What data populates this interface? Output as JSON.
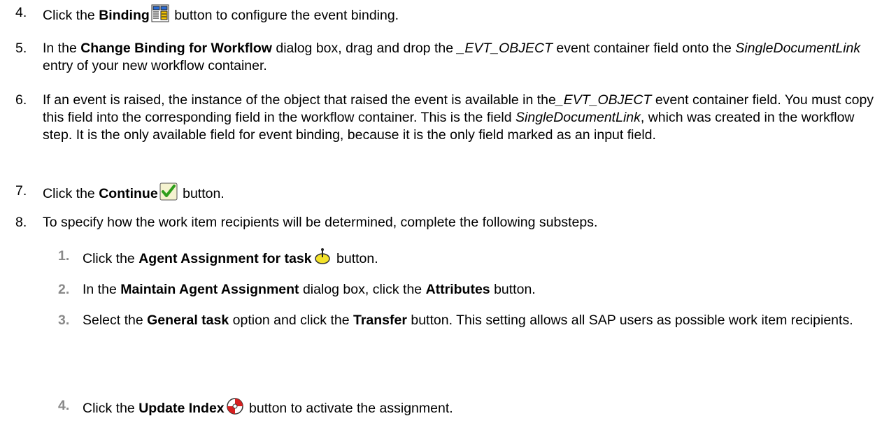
{
  "steps": [
    {
      "num": "4.",
      "parts": [
        {
          "t": "Click the "
        },
        {
          "t": "Binding",
          "b": true
        },
        {
          "t": " ",
          "icon": "binding-icon"
        },
        {
          "t": " button to configure the event binding."
        }
      ]
    },
    {
      "num": "5.",
      "parts": [
        {
          "t": "In the "
        },
        {
          "t": "Change Binding for Workflow",
          "b": true
        },
        {
          "t": " dialog box, drag and drop the "
        },
        {
          "t": "_EVT_OBJECT",
          "i": true
        },
        {
          "t": " event container field onto the "
        },
        {
          "t": "SingleDocumentLink",
          "i": true
        },
        {
          "t": " entry of your new workflow container."
        }
      ]
    },
    {
      "num": "6.",
      "parts": [
        {
          "t": "If an event is raised, the instance of the object that raised the event is available in the"
        },
        {
          "t": "_EVT_OBJECT",
          "i": true
        },
        {
          "t": " event container field. You must copy this field into the corresponding field in the workflow container. This is the field "
        },
        {
          "t": "SingleDocumentLink",
          "i": true
        },
        {
          "t": ", which was created in the workflow step. It is the only available field for event binding, because it is the only field marked as an input field."
        }
      ]
    },
    {
      "num": "7.",
      "parts": [
        {
          "t": "Click the "
        },
        {
          "t": "Continue",
          "b": true
        },
        {
          "t": " ",
          "icon": "checkmark-icon"
        },
        {
          "t": " button."
        }
      ]
    },
    {
      "num": "8.",
      "parts": [
        {
          "t": "To specify how the work item recipients will be determined, complete the following substeps."
        }
      ]
    }
  ],
  "substeps": [
    {
      "num": "1.",
      "parts": [
        {
          "t": "Click the "
        },
        {
          "t": "Agent Assignment for task",
          "b": true
        },
        {
          "t": " ",
          "icon": "agent-assignment-icon"
        },
        {
          "t": " button."
        }
      ]
    },
    {
      "num": "2.",
      "parts": [
        {
          "t": "In the "
        },
        {
          "t": "Maintain Agent Assignment",
          "b": true
        },
        {
          "t": " dialog box, click the "
        },
        {
          "t": "Attributes",
          "b": true
        },
        {
          "t": " button."
        }
      ]
    },
    {
      "num": "3.",
      "parts": [
        {
          "t": "Select the "
        },
        {
          "t": "General task",
          "b": true
        },
        {
          "t": " option and click the "
        },
        {
          "t": "Transfer",
          "b": true
        },
        {
          "t": " button. This setting allows all SAP users as possible work item recipients."
        }
      ]
    },
    {
      "num": "4.",
      "parts": [
        {
          "t": "Click the "
        },
        {
          "t": "Update Index",
          "b": true
        },
        {
          "t": " ",
          "icon": "update-index-icon"
        },
        {
          "t": " button to activate the assignment."
        }
      ]
    }
  ]
}
